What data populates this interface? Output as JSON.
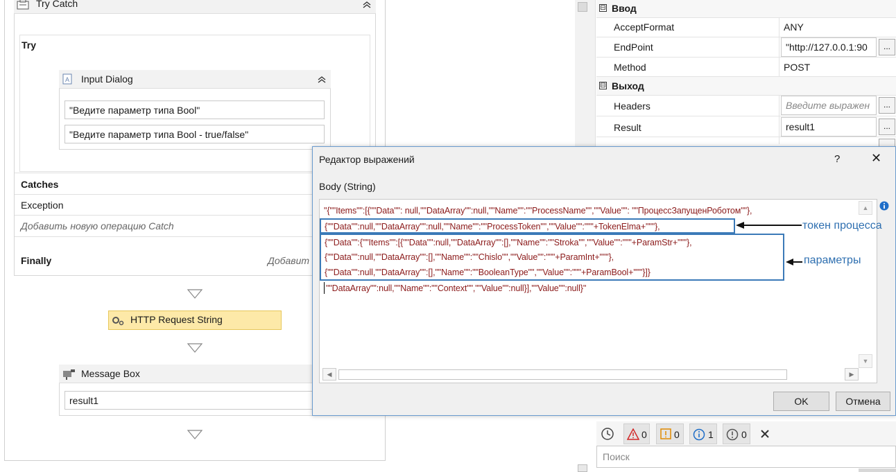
{
  "designer": {
    "try_catch": {
      "title": "Try Catch",
      "try_label": "Try",
      "input_dialog": {
        "title": "Input Dialog",
        "field1": "\"Ведите параметр типа Bool\"",
        "field2": "\"Ведите параметр типа Bool - true/false\""
      },
      "catches_label": "Catches",
      "exception_label": "Exception",
      "add_catch_text": "Добавить новую операцию Catch",
      "finally_label": "Finally",
      "finally_add_text": "Добавит"
    },
    "http_request_label": "HTTP Request String",
    "message_box": {
      "title": "Message Box",
      "value": "result1"
    }
  },
  "properties": {
    "categories": [
      {
        "label": "Ввод",
        "expander": "⊟"
      },
      {
        "label": "Выход",
        "expander": "⊟"
      }
    ],
    "input_rows": [
      {
        "name": "AcceptFormat",
        "value": "ANY"
      },
      {
        "name": "EndPoint",
        "value": "\"http://127.0.0.1:90"
      },
      {
        "name": "Method",
        "value": "POST"
      }
    ],
    "output_rows": [
      {
        "name": "Headers",
        "placeholder": "Введите выражен"
      },
      {
        "name": "Result",
        "value": "result1"
      }
    ],
    "dots_label": "..."
  },
  "error_list": {
    "errors": "0",
    "warnings": "0",
    "info": "1",
    "messages": "0",
    "search_placeholder": "Поиск"
  },
  "dialog": {
    "title": "Редактор выражений",
    "help": "?",
    "close": "✕",
    "body_label": "Body (String)",
    "code_lines": [
      "\"{\"\"Items\"\":[{\"\"Data\"\": null,\"\"DataArray\"\":null,\"\"Name\"\":\"\"ProcessName\"\",\"\"Value\"\": \"\"ПроцессЗапущенРоботом\"\"},",
      "{\"\"Data\"\":null,\"\"DataArray\"\":null,\"\"Name\"\":\"\"ProcessToken\"\",\"\"Value\"\":\"\"\"+TokenElma+\"\"\"},",
      "{\"\"Data\"\":{\"\"Items\"\":[{\"\"Data\"\":null,\"\"DataArray\"\":[],\"\"Name\"\":\"\"Stroka\"\",\"\"Value\"\":\"\"\"+ParamStr+\"\"\"},",
      "{\"\"Data\"\":null,\"\"DataArray\"\":[],\"\"Name\"\":\"\"Chislo\"\",\"\"Value\"\":\"\"\"+ParamInt+\"\"\"},",
      "{\"\"Data\"\":null,\"\"DataArray\"\":[],\"\"Name\"\":\"\"BooleanType\"\",\"\"Value\"\":\"\"\"+ParamBool+\"\"\"}]}",
      "\"\"DataArray\"\":null,\"\"Name\"\":\"\"Context\"\",\"\"Value\"\":null}],\"\"Value\"\":null}\""
    ],
    "annotation_token": "токен процесса",
    "annotation_params": "параметры",
    "ok_label": "OK",
    "cancel_label": "Отмена"
  }
}
